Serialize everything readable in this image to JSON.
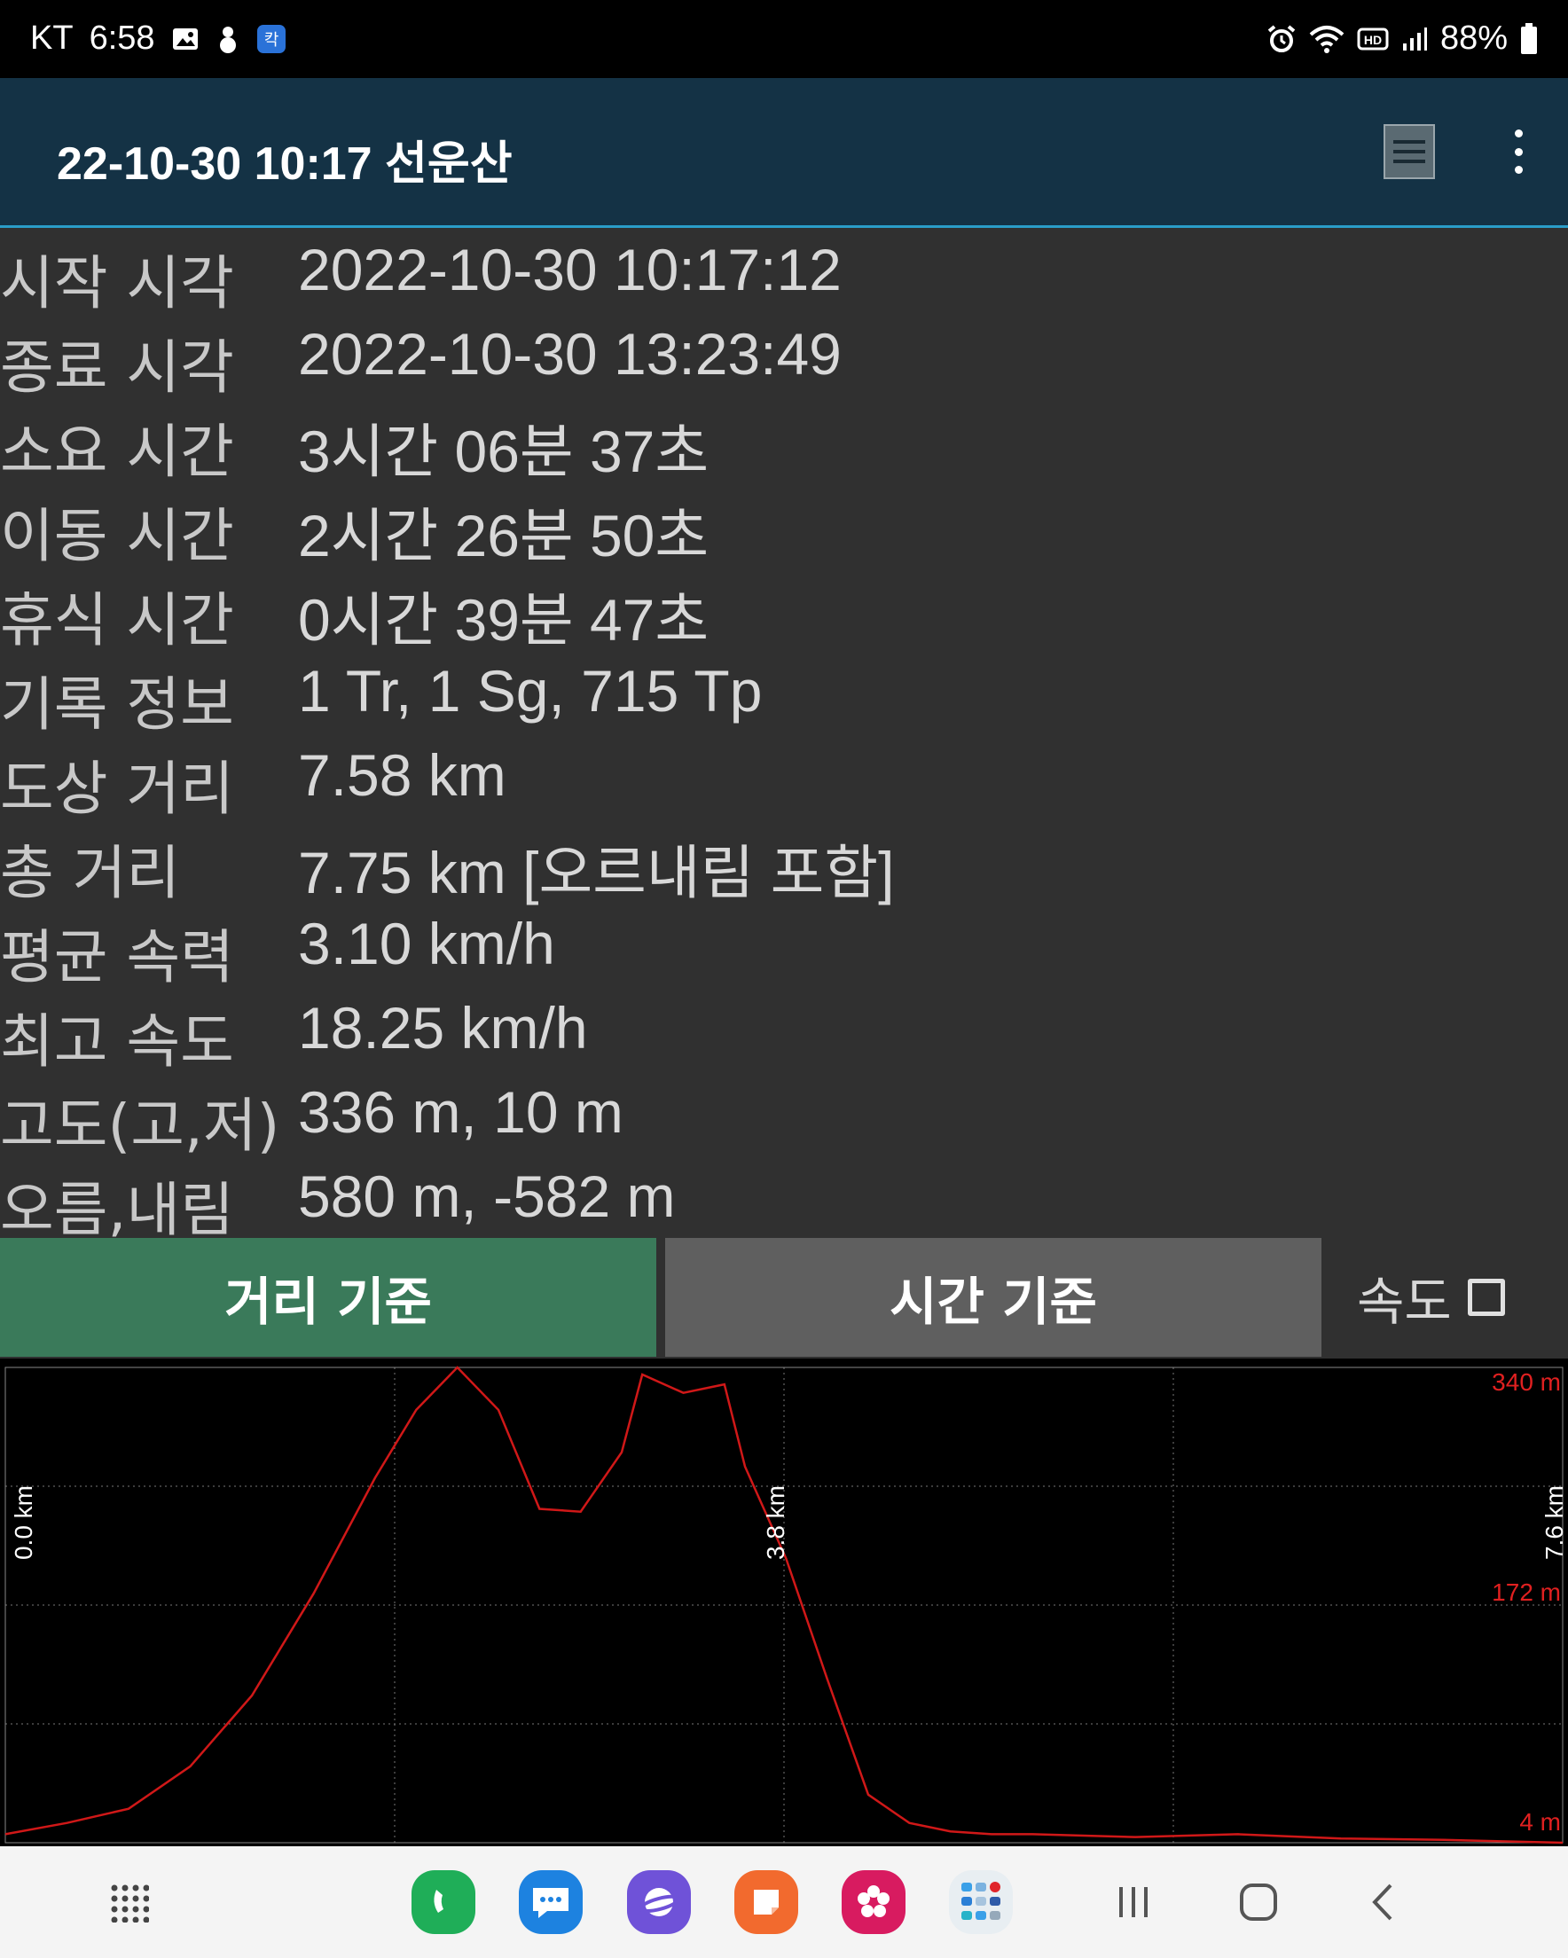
{
  "status_bar": {
    "carrier": "KT",
    "time": "6:58",
    "battery": "88%",
    "icons_left": [
      "gallery-icon",
      "snowman-icon",
      "app-badge-icon"
    ],
    "icons_right": [
      "alarm-icon",
      "wifi-icon",
      "hd-icon",
      "signal-icon",
      "battery-icon"
    ]
  },
  "app_bar": {
    "title": "22-10-30 10:17 선운산",
    "icons": [
      "list-icon",
      "more-vert-icon"
    ]
  },
  "stats": [
    {
      "label": "시작 시각",
      "value": "2022-10-30 10:17:12"
    },
    {
      "label": "종료 시각",
      "value": "2022-10-30 13:23:49"
    },
    {
      "label": "소요 시간",
      "value": "3시간 06분 37초"
    },
    {
      "label": "이동 시간",
      "value": "2시간 26분 50초"
    },
    {
      "label": "휴식 시간",
      "value": "0시간 39분 47초"
    },
    {
      "label": "기록 정보",
      "value": "1 Tr, 1 Sg, 715 Tp"
    },
    {
      "label": "도상 거리",
      "value": "7.58 km"
    },
    {
      "label": "총 거리",
      "value": "7.75 km [오르내림 포함]"
    },
    {
      "label": "평균 속력",
      "value": "3.10 km/h"
    },
    {
      "label": "최고 속도",
      "value": "18.25 km/h"
    },
    {
      "label": "고도(고,저)",
      "value": "336 m, 10 m"
    },
    {
      "label": "오름,내림",
      "value": "580 m, -582 m"
    }
  ],
  "tabs": {
    "distance": "거리 기준",
    "time": "시간 기준",
    "speed": "속도",
    "active": "distance",
    "active_color": "#3a7a5a"
  },
  "chart_data": {
    "type": "line",
    "x_labels": [
      "0.0 km",
      "3.8 km",
      "7.6 km"
    ],
    "y_labels": [
      "340 m",
      "172 m",
      "4 m"
    ],
    "xlim": [
      0,
      7.58
    ],
    "ylim": [
      4,
      340
    ],
    "line_color": "#d01818",
    "x": [
      0.0,
      0.3,
      0.6,
      0.9,
      1.2,
      1.5,
      1.8,
      2.0,
      2.2,
      2.4,
      2.6,
      2.8,
      3.0,
      3.1,
      3.3,
      3.5,
      3.6,
      3.8,
      4.0,
      4.2,
      4.4,
      4.6,
      4.8,
      5.0,
      5.5,
      6.0,
      6.5,
      7.0,
      7.58
    ],
    "y": [
      10,
      18,
      28,
      58,
      108,
      180,
      262,
      310,
      340,
      310,
      240,
      238,
      280,
      335,
      322,
      328,
      270,
      205,
      120,
      38,
      18,
      12,
      10,
      10,
      8,
      10,
      7,
      6,
      4
    ],
    "grid": true
  },
  "nav_bar": {
    "apps": [
      "apps-grid-icon",
      "phone-app-icon",
      "messages-app-icon",
      "internet-app-icon",
      "notes-app-icon",
      "gallery-app-icon",
      "folder-app-icon"
    ],
    "buttons": [
      "recents-icon",
      "home-icon",
      "back-icon"
    ]
  }
}
